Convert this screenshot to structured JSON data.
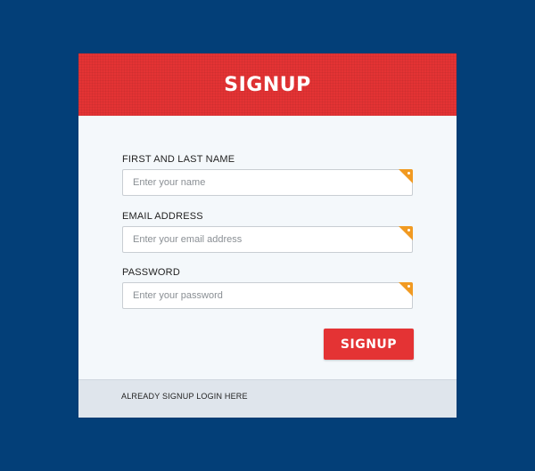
{
  "colors": {
    "background": "#033f78",
    "header": "#e43334",
    "button": "#e43334",
    "required_marker": "#f19a21",
    "card": "#f4f8fb",
    "footer": "#dfe5ec"
  },
  "header": {
    "title": "SIGNUP"
  },
  "form": {
    "fields": [
      {
        "label": "FIRST AND LAST NAME",
        "placeholder": "Enter your name",
        "value": "",
        "required_icon": "required-corner-icon"
      },
      {
        "label": "EMAIL ADDRESS",
        "placeholder": "Enter your email address",
        "value": "",
        "required_icon": "required-corner-icon"
      },
      {
        "label": "PASSWORD",
        "placeholder": "Enter your password",
        "value": "",
        "required_icon": "required-corner-icon"
      }
    ],
    "submit_label": "SIGNUP"
  },
  "footer": {
    "link_text": "ALREADY SIGNUP LOGIN HERE"
  }
}
